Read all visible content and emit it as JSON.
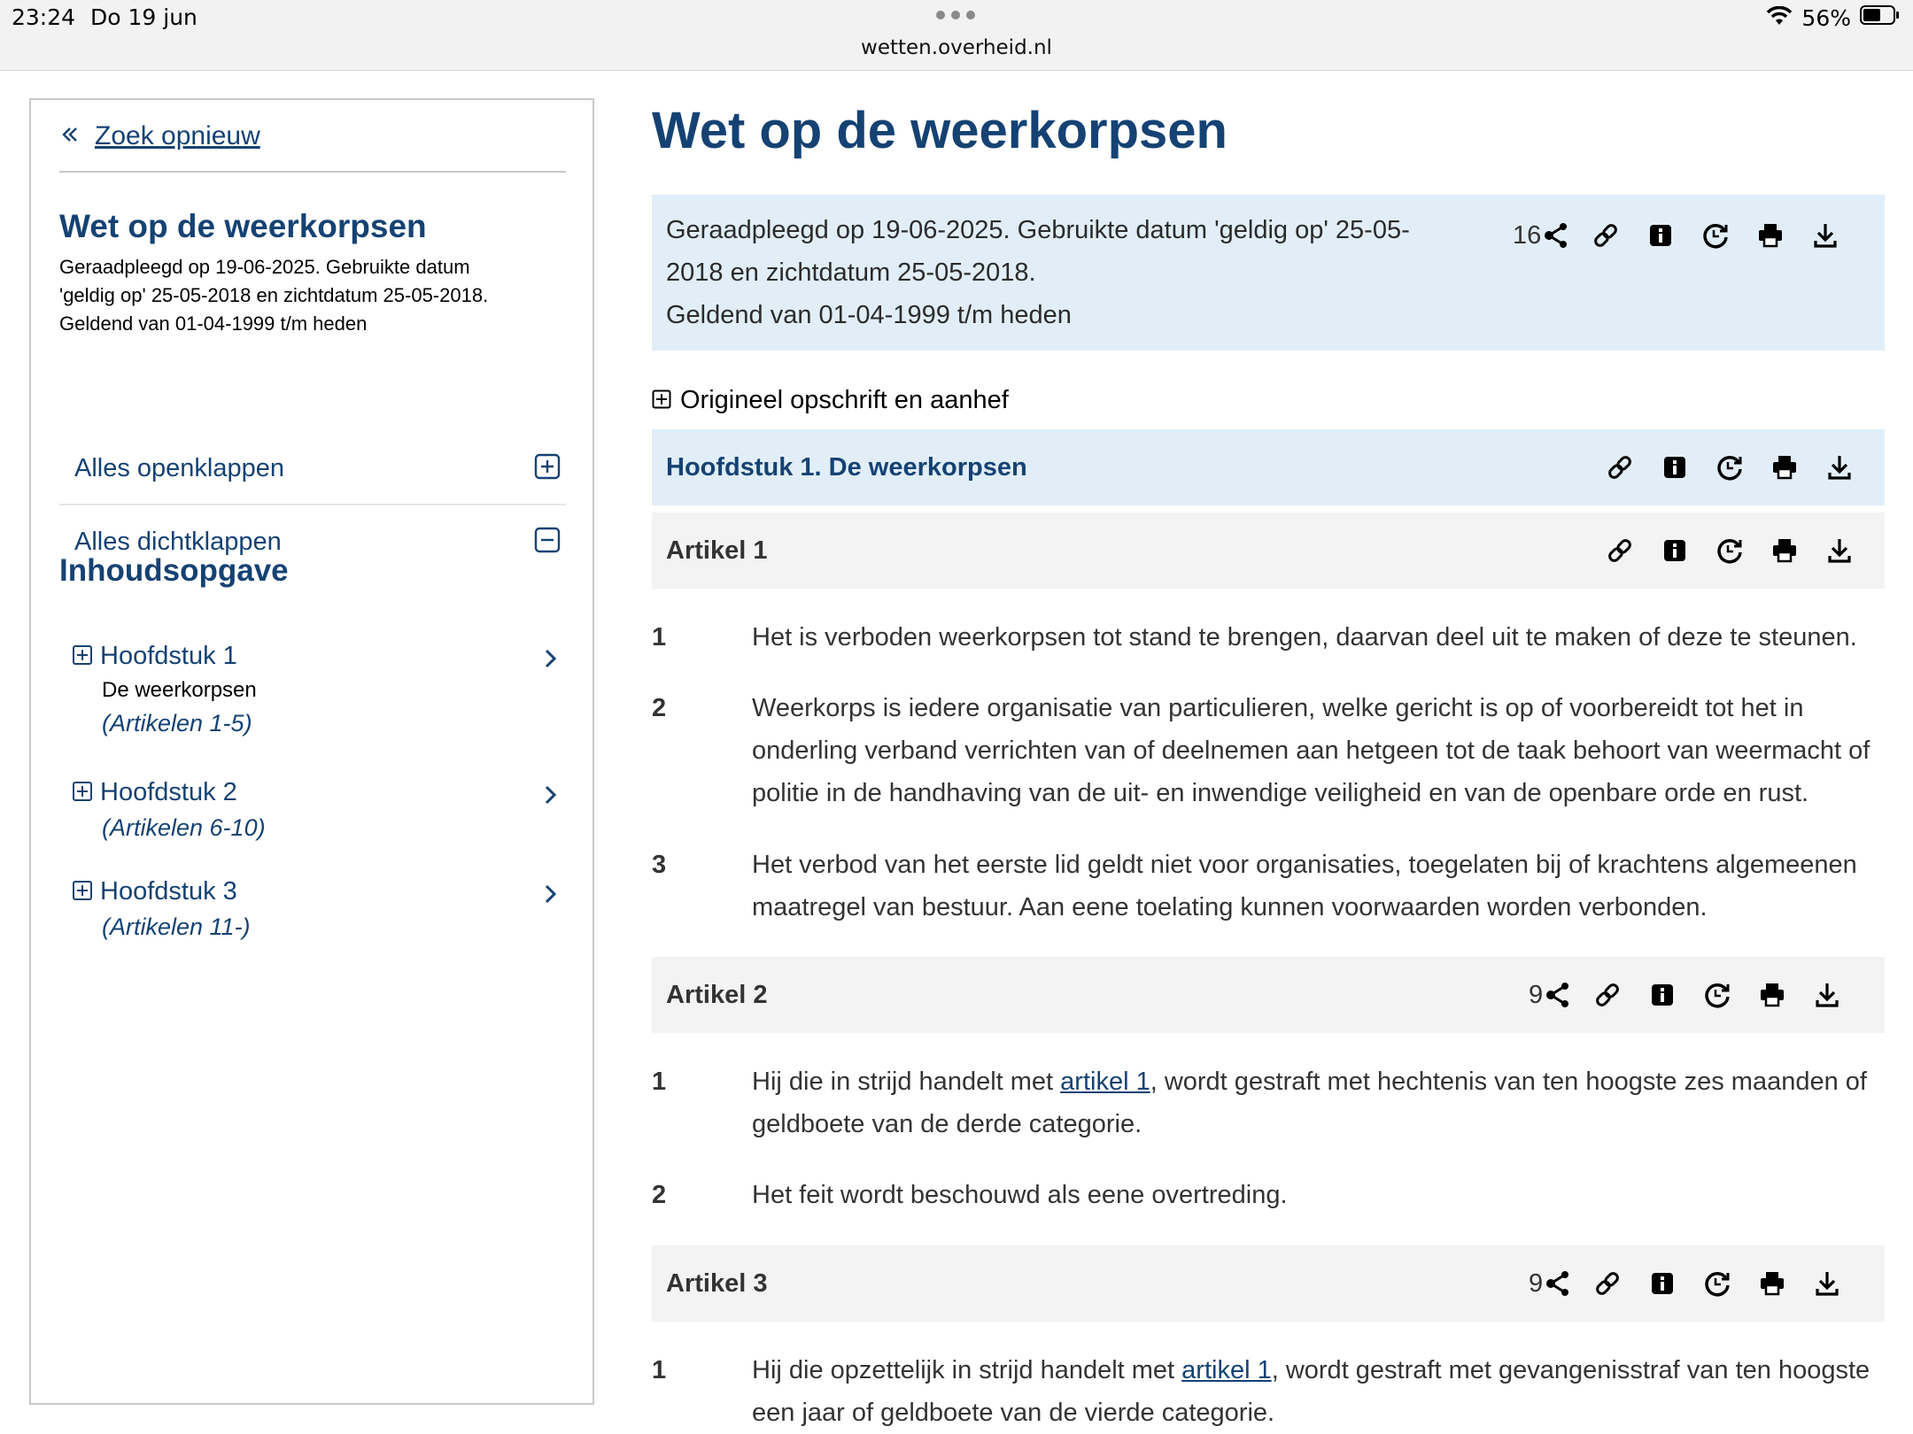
{
  "status_bar": {
    "time": "23:24",
    "date": "Do 19 jun",
    "url": "wetten.overheid.nl",
    "battery": "56%"
  },
  "colors": {
    "brand_blue": "#154273",
    "info_bg": "#e1eef7",
    "article_bg": "#f3f3f3"
  },
  "sidebar": {
    "back_link": "Zoek opnieuw",
    "title": "Wet op de weerkorpsen",
    "info_lines": [
      "Geraadpleegd op 19-06-2025. Gebruikte datum",
      "'geldig op' 25-05-2018 en zichtdatum 25-05-2018.",
      "Geldend van 01-04-1999 t/m heden"
    ],
    "expand_all": "Alles openklappen",
    "collapse_all": "Alles dichtklappen",
    "toc_title": "Inhoudsopgave",
    "toc": [
      {
        "label": "Hoofdstuk 1",
        "subtitle": "De weerkorpsen",
        "range": "(Artikelen 1-5)"
      },
      {
        "label": "Hoofdstuk 2",
        "range": "(Artikelen 6-10)"
      },
      {
        "label": "Hoofdstuk 3",
        "range": "(Artikelen 11-)"
      }
    ]
  },
  "main": {
    "title": "Wet op de weerkorpsen",
    "info_lines": [
      "Geraadpleegd op 19-06-2025. Gebruikte datum 'geldig op' 25-05-",
      "2018 en zichtdatum 25-05-2018.",
      "Geldend van 01-04-1999 t/m heden"
    ],
    "info_share_count": "16",
    "original_heading": "Origineel opschrift en aanhef",
    "chapter_title": "Hoofdstuk 1. De weerkorpsen",
    "articles": [
      {
        "title": "Artikel 1",
        "share_count": "",
        "paragraphs": [
          {
            "num": "1",
            "text": "Het is verboden weerkorpsen tot stand te brengen, daarvan deel uit te maken of deze te steunen."
          },
          {
            "num": "2",
            "text": "Weerkorps is iedere organisatie van particulieren, welke gericht is op of voorbereidt tot het in onderling verband verrichten van of deelnemen aan hetgeen tot de taak behoort van weermacht of politie in de handhaving van de uit- en inwendige veiligheid en van de openbare orde en rust."
          },
          {
            "num": "3",
            "text": "Het verbod van het eerste lid geldt niet voor organisaties, toegelaten bij of krachtens algemeenen maatregel van bestuur. Aan eene toelating kunnen voorwaarden worden verbonden."
          }
        ]
      },
      {
        "title": "Artikel 2",
        "share_count": "9",
        "paragraphs": [
          {
            "num": "1",
            "before": "Hij die in strijd handelt met ",
            "link": "artikel 1",
            "after": ", wordt gestraft met hechtenis van ten hoogste zes maanden of geldboete van de derde categorie."
          },
          {
            "num": "2",
            "text": "Het feit wordt beschouwd als eene overtreding."
          }
        ]
      },
      {
        "title": "Artikel 3",
        "share_count": "9",
        "paragraphs": [
          {
            "num": "1",
            "before": "Hij die opzettelijk in strijd handelt met ",
            "link": "artikel 1",
            "after": ", wordt gestraft met gevangenisstraf van ten hoogste een jaar of geldboete van de vierde categorie."
          }
        ]
      }
    ]
  }
}
